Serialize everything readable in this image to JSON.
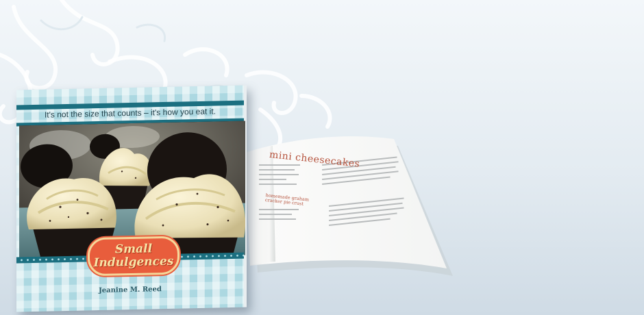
{
  "book": {
    "tagline": "It's not the size that counts – it's how you eat it.",
    "title": "Small Indulgences",
    "title_line1": "Small",
    "title_line2": "Indulgences",
    "author": "Jeanine M. Reed"
  },
  "open_book": {
    "recipe_title": "mini cheesecakes",
    "subheading": "homemade graham cracker pie crust"
  },
  "colors": {
    "accent_teal": "#1b6f80",
    "badge_orange": "#e85d3c",
    "badge_cream": "#f7e4a6",
    "recipe_red": "#b5523c"
  }
}
